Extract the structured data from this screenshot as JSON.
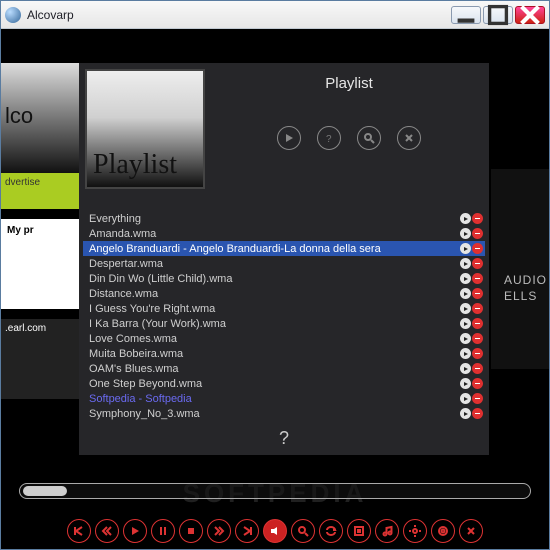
{
  "window": {
    "title": "Alcovarp"
  },
  "bg": {
    "left1": "lco",
    "left2": "dvertise",
    "left3": "My pr",
    "left4": ".earl.com",
    "right": "AUDIO\nELLS",
    "watermark": "SOFTPEDIA"
  },
  "panel": {
    "title": "Playlist",
    "cover_label": "Playlist",
    "question": "?",
    "selected_index": 2,
    "alt_color_index": 12,
    "tracks": [
      "Everything",
      "Amanda.wma",
      "Angelo Branduardi - Angelo Branduardi-La donna della sera",
      "Despertar.wma",
      "Din Din Wo (Little Child).wma",
      "Distance.wma",
      "I Guess You're Right.wma",
      "I Ka Barra (Your Work).wma",
      "Love Comes.wma",
      "Muita Bobeira.wma",
      "OAM's Blues.wma",
      "One Step Beyond.wma",
      "Softpedia - Softpedia",
      "Symphony_No_3.wma"
    ]
  },
  "bottom": {
    "active_index": 7
  }
}
